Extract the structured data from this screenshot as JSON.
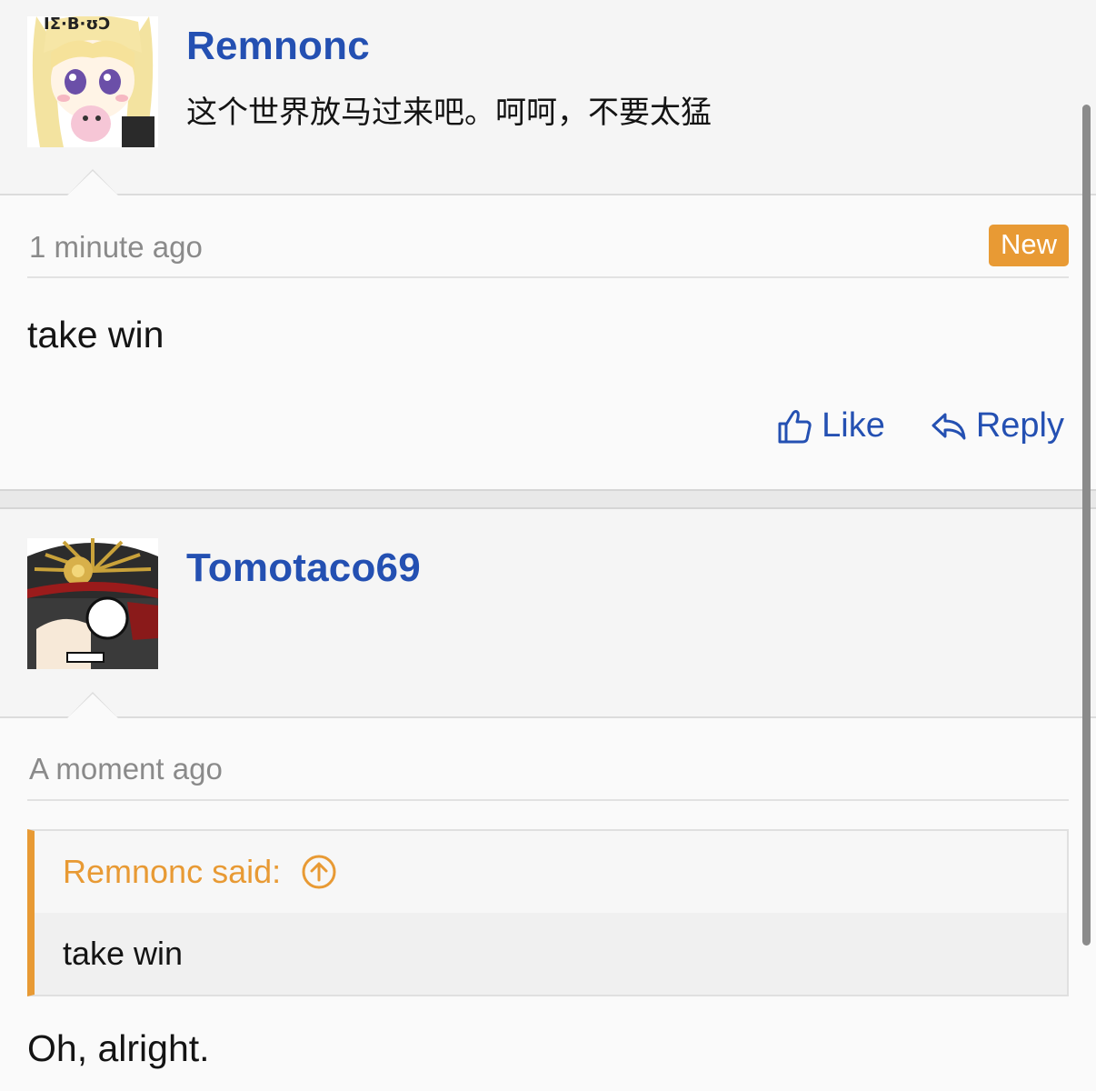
{
  "posts": [
    {
      "username": "Remnonc",
      "user_title": "这个世界放马过来吧。呵呵，不要太猛",
      "avatar_icon": "anime-girl-avatar",
      "time": "1 minute ago",
      "badge": "New",
      "message": "take win",
      "actions": {
        "like": "Like",
        "reply": "Reply"
      }
    },
    {
      "username": "Tomotaco69",
      "user_title": "",
      "avatar_icon": "anime-officer-avatar",
      "time": "A moment ago",
      "quote": {
        "author_said": "Remnonc said:",
        "text": "take win"
      },
      "message": "Oh, alright."
    }
  ],
  "colors": {
    "link_blue": "#2450b2",
    "accent_orange": "#e89a34",
    "muted_text": "#8a8a8a"
  }
}
